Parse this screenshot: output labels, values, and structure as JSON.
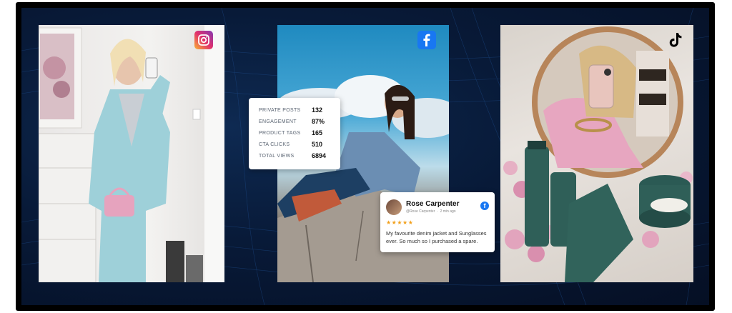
{
  "panels": {
    "instagram": {
      "icon": "instagram-icon"
    },
    "facebook": {
      "icon": "facebook-icon"
    },
    "tiktok": {
      "icon": "tiktok-icon"
    }
  },
  "stats": {
    "rows": [
      {
        "label": "PRIVATE POSTS",
        "value": "132"
      },
      {
        "label": "ENGAGEMENT",
        "value": "87%"
      },
      {
        "label": "PRODUCT TAGS",
        "value": "165"
      },
      {
        "label": "CTA CLICKS",
        "value": "510"
      },
      {
        "label": "TOTAL VIEWS",
        "value": "6894"
      }
    ]
  },
  "review": {
    "name": "Rose Carpenter",
    "handle": "@Rose Carpenter",
    "time": "2 min ago",
    "stars": "★★★★★",
    "rating": 5,
    "text": "My favourite denim jacket and Sunglasses ever. So much so I purchased a spare."
  },
  "colors": {
    "background": "#081a38",
    "frame": "#000000",
    "facebook": "#1877f2",
    "star": "#f2a01c"
  }
}
